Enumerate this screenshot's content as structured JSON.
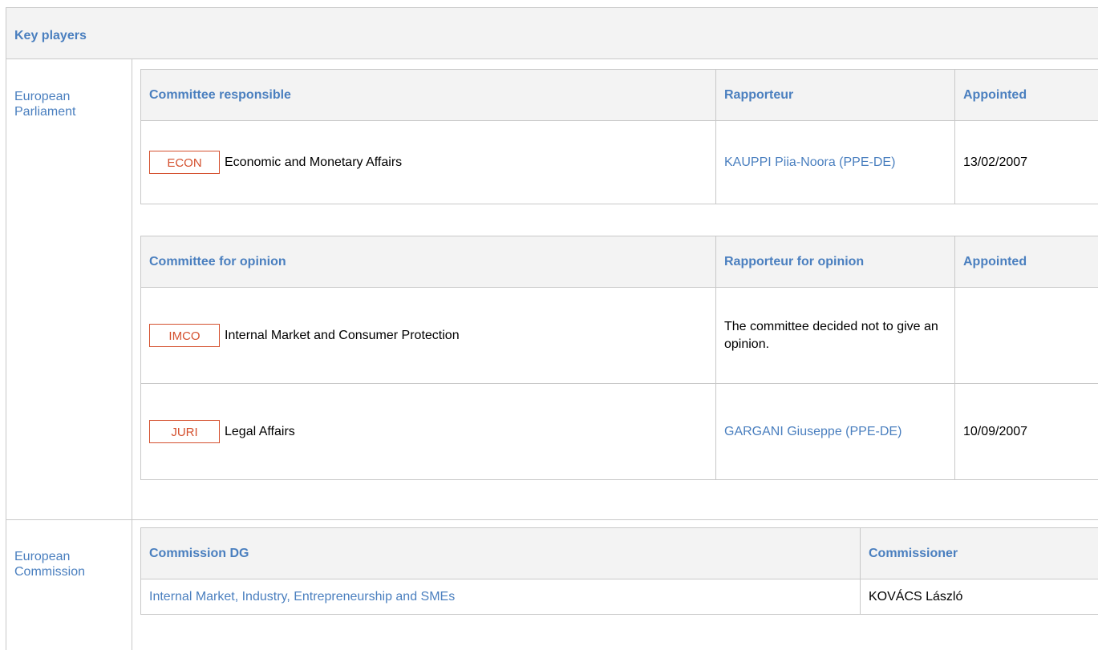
{
  "section_title": "Key players",
  "parliament": {
    "label": "European Parliament",
    "responsible": {
      "headers": {
        "committee": "Committee responsible",
        "rapporteur": "Rapporteur",
        "appointed": "Appointed"
      },
      "rows": [
        {
          "code": "ECON",
          "name": "Economic and Monetary Affairs",
          "rapporteur": "KAUPPI Piia-Noora (PPE-DE)",
          "appointed": "13/02/2007"
        }
      ]
    },
    "opinion": {
      "headers": {
        "committee": "Committee for opinion",
        "rapporteur": "Rapporteur for opinion",
        "appointed": "Appointed"
      },
      "rows": [
        {
          "code": "IMCO",
          "name": "Internal Market and Consumer Protection",
          "rapporteur": "The committee decided not to give an opinion.",
          "appointed": ""
        },
        {
          "code": "JURI",
          "name": "Legal Affairs",
          "rapporteur": "GARGANI Giuseppe (PPE-DE)",
          "appointed": "10/09/2007"
        }
      ]
    }
  },
  "commission": {
    "label": "European Commission",
    "headers": {
      "dg": "Commission DG",
      "commissioner": "Commissioner"
    },
    "rows": [
      {
        "dg": "Internal Market, Industry, Entrepreneurship and SMEs",
        "commissioner": "KOVÁCS László"
      }
    ]
  },
  "colors": {
    "link": "#4a7fbf",
    "badge": "#d4502e",
    "header_bg": "#f3f3f3",
    "border": "#c8c8c8"
  }
}
